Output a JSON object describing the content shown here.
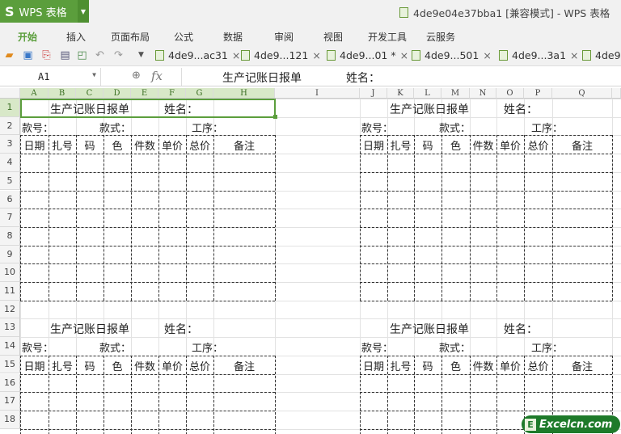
{
  "app": {
    "logo": "S",
    "name": "WPS 表格",
    "window_title": "4de9e04e37bba1 [兼容模式] - WPS 表格"
  },
  "menu": [
    "开始",
    "插入",
    "页面布局",
    "公式",
    "数据",
    "审阅",
    "视图",
    "开发工具",
    "云服务"
  ],
  "active_menu": "开始",
  "tabs": [
    {
      "label": "4de9...ac31",
      "close": "×"
    },
    {
      "label": "4de9...121",
      "close": "×"
    },
    {
      "label": "4de9...01 *",
      "close": "×"
    },
    {
      "label": "4de9...501",
      "close": "×"
    },
    {
      "label": "4de9...3a1",
      "close": "×"
    },
    {
      "label": "4de9",
      "close": ""
    }
  ],
  "formula_bar": {
    "cell_ref": "A1",
    "fx": "fx",
    "content_title": "生产记账日报单",
    "content_name": "姓名："
  },
  "columns": [
    "A",
    "B",
    "C",
    "D",
    "E",
    "F",
    "G",
    "H",
    "I",
    "J",
    "K",
    "L",
    "M",
    "N",
    "O",
    "P",
    "Q"
  ],
  "rows": [
    "1",
    "2",
    "3",
    "4",
    "5",
    "6",
    "7",
    "8",
    "9",
    "10",
    "11",
    "12",
    "13",
    "14",
    "15",
    "16",
    "17",
    "18"
  ],
  "form": {
    "title": "生产记账日报单",
    "name_label": "姓名：",
    "style_no_label": "款号：",
    "style_label": "款式：",
    "process_label": "工序：",
    "headers": [
      "日期",
      "扎号",
      "码",
      "色",
      "件数",
      "单价",
      "总价",
      "备注"
    ]
  },
  "watermark": {
    "icon": "E",
    "text": "Excelcn.com"
  },
  "colors": {
    "accent": "#5b9e3c"
  }
}
